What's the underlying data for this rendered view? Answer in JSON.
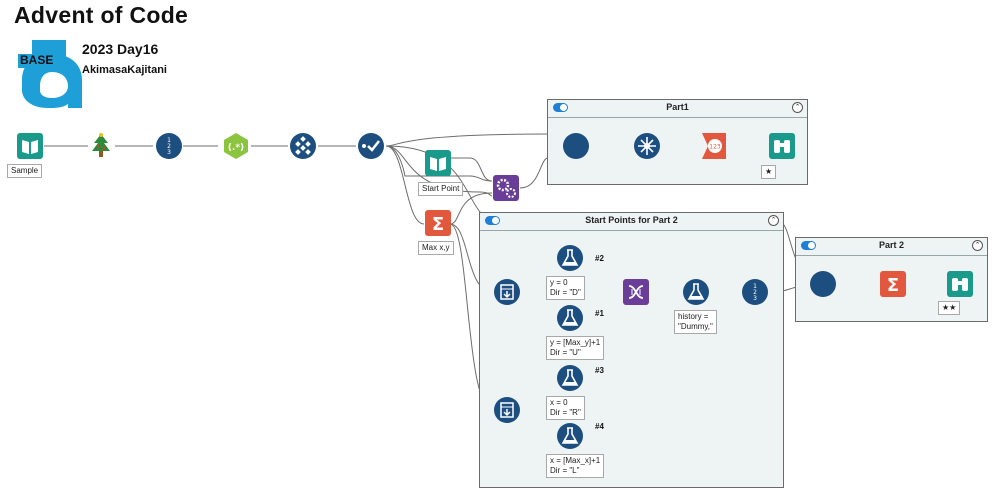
{
  "header": {
    "title": "Advent of Code",
    "year_day": "2023   Day16",
    "author": "AkimasaKajitani",
    "logo_text": "BASE"
  },
  "containers": {
    "part1": {
      "title": "Part1"
    },
    "start_points": {
      "title": "Start Points for Part 2"
    },
    "part2": {
      "title": "Part 2"
    }
  },
  "annotations": {
    "sample": "Sample",
    "start_point": "Start Point",
    "max_xy": "Max x,y",
    "star1": "★",
    "star2": "★★",
    "formula_top": "y = 0\nDir = \"D\"",
    "formula_up": "y = [Max_y]+1\nDir = \"U\"",
    "formula_right": "x = 0\nDir = \"R\"",
    "formula_left": "x = [Max_x]+1\nDir = \"L\"",
    "history": "history =\n\"Dummy,\""
  },
  "tags": {
    "n1": "#1",
    "n2": "#2",
    "n3": "#3",
    "n4": "#4"
  },
  "colors": {
    "blue_tool": "#1c4e80",
    "teal_tool": "#1a9a8a",
    "orange_tool": "#e2583e",
    "purple_tool": "#6a3e98",
    "green_tool": "#8bc53f",
    "wire": "#6d6d6d",
    "anchor": "#9dcf4a"
  },
  "icons": {
    "input": "book-icon",
    "tree": "christmas-tree-icon",
    "record_id": "record-id-icon",
    "regex": "regex-icon",
    "text_to_cols": "text-to-columns-icon",
    "select": "select-icon",
    "macro": "macro-gears-icon",
    "summarize": "sigma-icon",
    "generate_rows": "generate-rows-icon",
    "formula": "flask-icon",
    "union": "union-dna-icon",
    "browse": "binoculars-icon"
  }
}
